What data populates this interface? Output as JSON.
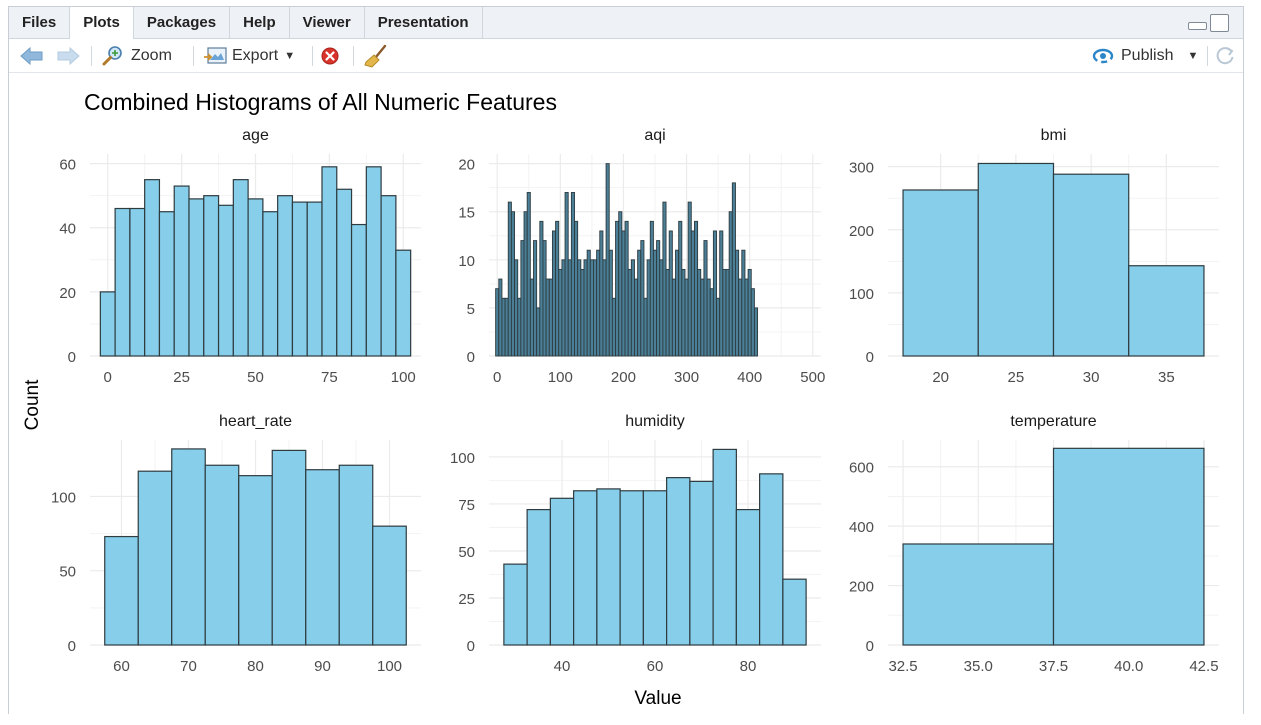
{
  "tabs": [
    {
      "label": "Files",
      "active": false
    },
    {
      "label": "Plots",
      "active": true
    },
    {
      "label": "Packages",
      "active": false
    },
    {
      "label": "Help",
      "active": false
    },
    {
      "label": "Viewer",
      "active": false
    },
    {
      "label": "Presentation",
      "active": false
    }
  ],
  "toolbar": {
    "zoom_label": "Zoom",
    "export_label": "Export",
    "publish_label": "Publish",
    "icons": [
      "back-arrow-icon",
      "forward-arrow-icon",
      "zoom-icon",
      "export-icon",
      "remove-plot-icon",
      "clear-broom-icon",
      "publish-icon",
      "refresh-icon"
    ]
  },
  "colors": {
    "bar_fill": "#87ceeb",
    "bar_stroke": "#2e3b3f",
    "grid": "#ebebeb",
    "aqi_fill": "#4a7f97"
  },
  "plot": {
    "title": "Combined Histograms of All Numeric Features",
    "xlabel": "Value",
    "ylabel": "Count"
  },
  "chart_data": [
    {
      "type": "bar",
      "title": "age",
      "bins": [
        {
          "x0": -2.5,
          "x1": 2.5,
          "count": 20
        },
        {
          "x0": 2.5,
          "x1": 7.5,
          "count": 46
        },
        {
          "x0": 7.5,
          "x1": 12.5,
          "count": 46
        },
        {
          "x0": 12.5,
          "x1": 17.5,
          "count": 55
        },
        {
          "x0": 17.5,
          "x1": 22.5,
          "count": 45
        },
        {
          "x0": 22.5,
          "x1": 27.5,
          "count": 53
        },
        {
          "x0": 27.5,
          "x1": 32.5,
          "count": 49
        },
        {
          "x0": 32.5,
          "x1": 37.5,
          "count": 50
        },
        {
          "x0": 37.5,
          "x1": 42.5,
          "count": 47
        },
        {
          "x0": 42.5,
          "x1": 47.5,
          "count": 55
        },
        {
          "x0": 47.5,
          "x1": 52.5,
          "count": 49
        },
        {
          "x0": 52.5,
          "x1": 57.5,
          "count": 45
        },
        {
          "x0": 57.5,
          "x1": 62.5,
          "count": 50
        },
        {
          "x0": 62.5,
          "x1": 67.5,
          "count": 48
        },
        {
          "x0": 67.5,
          "x1": 72.5,
          "count": 48
        },
        {
          "x0": 72.5,
          "x1": 77.5,
          "count": 59
        },
        {
          "x0": 77.5,
          "x1": 82.5,
          "count": 52
        },
        {
          "x0": 82.5,
          "x1": 87.5,
          "count": 41
        },
        {
          "x0": 87.5,
          "x1": 92.5,
          "count": 59
        },
        {
          "x0": 92.5,
          "x1": 97.5,
          "count": 50
        },
        {
          "x0": 97.5,
          "x1": 102.5,
          "count": 33
        }
      ],
      "xlim": [
        -6,
        106
      ],
      "ylim": [
        0,
        63
      ],
      "xticks": [
        0,
        25,
        50,
        75,
        100
      ],
      "yticks": [
        0,
        20,
        40,
        60
      ]
    },
    {
      "type": "bar",
      "title": "aqi",
      "bin_start": -2.5,
      "bin_width": 5,
      "counts": [
        7,
        8,
        6,
        6,
        16,
        15,
        10,
        6,
        12,
        15,
        17,
        8,
        12,
        5,
        14,
        12,
        8,
        8,
        13,
        14,
        9,
        10,
        17,
        10,
        17,
        14,
        10,
        9,
        10,
        11,
        10,
        10,
        11,
        13,
        10,
        20,
        11,
        6,
        14,
        15,
        13,
        14,
        9,
        10,
        8,
        11,
        12,
        6,
        10,
        14,
        11,
        12,
        10,
        16,
        9,
        13,
        8,
        11,
        14,
        9,
        8,
        16,
        13,
        14,
        9,
        8,
        12,
        8,
        7,
        13,
        6,
        13,
        9,
        9,
        15,
        18,
        11,
        8,
        11,
        8,
        9,
        7,
        5
      ],
      "xlim": [
        -13,
        513
      ],
      "ylim": [
        0,
        21
      ],
      "xticks": [
        0,
        100,
        200,
        300,
        400,
        500
      ],
      "yticks": [
        0,
        5,
        10,
        15,
        20
      ]
    },
    {
      "type": "bar",
      "title": "bmi",
      "bins": [
        {
          "x0": 17.5,
          "x1": 22.5,
          "count": 263
        },
        {
          "x0": 22.5,
          "x1": 27.5,
          "count": 305
        },
        {
          "x0": 27.5,
          "x1": 32.5,
          "count": 288
        },
        {
          "x0": 32.5,
          "x1": 37.5,
          "count": 143
        }
      ],
      "xlim": [
        16.5,
        38.5
      ],
      "ylim": [
        0,
        320
      ],
      "xticks": [
        20,
        25,
        30,
        35
      ],
      "yticks": [
        0,
        100,
        200,
        300
      ]
    },
    {
      "type": "bar",
      "title": "heart_rate",
      "bins": [
        {
          "x0": 57.5,
          "x1": 62.5,
          "count": 73
        },
        {
          "x0": 62.5,
          "x1": 67.5,
          "count": 117
        },
        {
          "x0": 67.5,
          "x1": 72.5,
          "count": 132
        },
        {
          "x0": 72.5,
          "x1": 77.5,
          "count": 121
        },
        {
          "x0": 77.5,
          "x1": 82.5,
          "count": 114
        },
        {
          "x0": 82.5,
          "x1": 87.5,
          "count": 131
        },
        {
          "x0": 87.5,
          "x1": 92.5,
          "count": 118
        },
        {
          "x0": 92.5,
          "x1": 97.5,
          "count": 121
        },
        {
          "x0": 97.5,
          "x1": 102.5,
          "count": 80
        }
      ],
      "xlim": [
        55.3,
        104.7
      ],
      "ylim": [
        0,
        138
      ],
      "xticks": [
        60,
        70,
        80,
        90,
        100
      ],
      "yticks": [
        0,
        50,
        100
      ]
    },
    {
      "type": "bar",
      "title": "humidity",
      "bins": [
        {
          "x0": 27.5,
          "x1": 32.5,
          "count": 43
        },
        {
          "x0": 32.5,
          "x1": 37.5,
          "count": 72
        },
        {
          "x0": 37.5,
          "x1": 42.5,
          "count": 78
        },
        {
          "x0": 42.5,
          "x1": 47.5,
          "count": 82
        },
        {
          "x0": 47.5,
          "x1": 52.5,
          "count": 83
        },
        {
          "x0": 52.5,
          "x1": 57.5,
          "count": 82
        },
        {
          "x0": 57.5,
          "x1": 62.5,
          "count": 82
        },
        {
          "x0": 62.5,
          "x1": 67.5,
          "count": 89
        },
        {
          "x0": 67.5,
          "x1": 72.5,
          "count": 87
        },
        {
          "x0": 72.5,
          "x1": 77.5,
          "count": 104
        },
        {
          "x0": 77.5,
          "x1": 82.5,
          "count": 72
        },
        {
          "x0": 82.5,
          "x1": 87.5,
          "count": 91
        },
        {
          "x0": 87.5,
          "x1": 92.5,
          "count": 35
        }
      ],
      "xlim": [
        24.3,
        95.7
      ],
      "ylim": [
        0,
        109
      ],
      "xticks": [
        40,
        60,
        80
      ],
      "yticks": [
        0,
        25,
        50,
        75,
        100
      ]
    },
    {
      "type": "bar",
      "title": "temperature",
      "bins": [
        {
          "x0": 32.5,
          "x1": 37.5,
          "count": 340
        },
        {
          "x0": 37.5,
          "x1": 42.5,
          "count": 662
        }
      ],
      "xlim": [
        32,
        43
      ],
      "ylim": [
        0,
        690
      ],
      "xticks": [
        32.5,
        35.0,
        37.5,
        40.0,
        42.5
      ],
      "ytick_labels": [
        "0",
        "200",
        "400",
        "600"
      ],
      "xtick_labels": [
        "32.5",
        "35.0",
        "37.5",
        "40.0",
        "42.5"
      ],
      "yticks": [
        0,
        200,
        400,
        600
      ]
    }
  ]
}
